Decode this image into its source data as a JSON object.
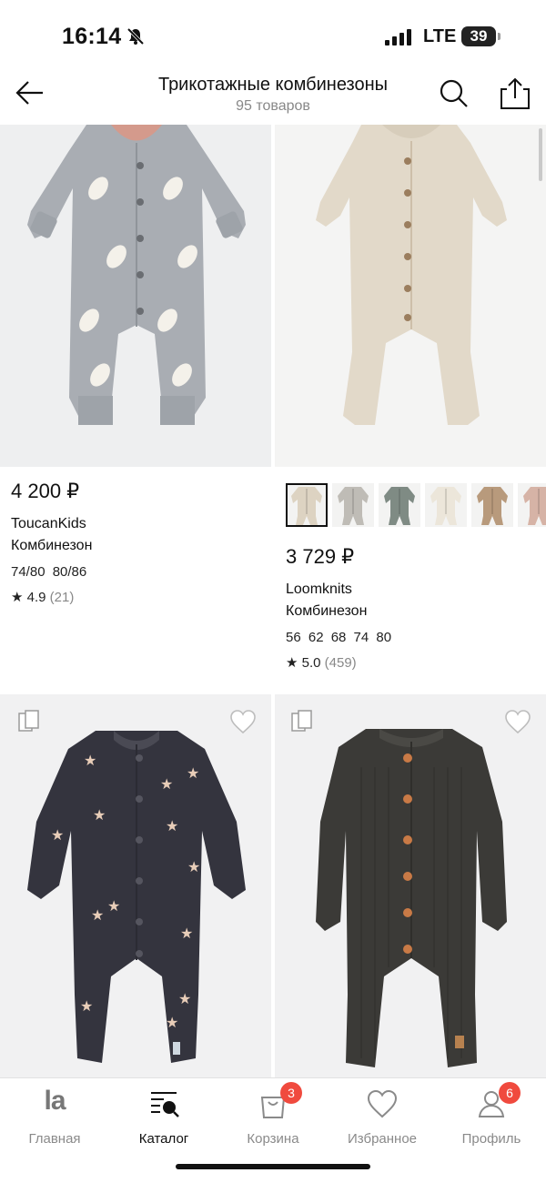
{
  "status_bar": {
    "time": "16:14",
    "network": "LTE",
    "battery": "39",
    "icons": [
      "bell-off-icon",
      "signal-bars-icon",
      "battery-icon"
    ]
  },
  "header": {
    "title": "Трикотажные комбинезоны",
    "subtitle": "95 товаров",
    "icons": [
      "back-arrow-icon",
      "search-icon",
      "share-icon"
    ]
  },
  "products": [
    {
      "price": "4 200 ₽",
      "brand": "ToucanKids",
      "type": "Комбинезон",
      "sizes": "74/80  80/86",
      "rating": "4.9",
      "reviews": "(21)",
      "color": "#a9adb3"
    },
    {
      "price": "3 729 ₽",
      "brand": "Loomknits",
      "type": "Комбинезон",
      "sizes": "56  62  68  74  80",
      "rating": "5.0",
      "reviews": "(459)",
      "color": "#e2d9c9",
      "color_variants": [
        "#ddd3c2",
        "#bfbcb6",
        "#7f8b84",
        "#ece6da",
        "#b89a7c",
        "#d6b3a6"
      ]
    },
    {
      "color": "#34343e",
      "accent": "#e8cdb8"
    },
    {
      "color": "#3b3a37",
      "accent": "#c97a46"
    }
  ],
  "tabs": [
    {
      "label": "Главная",
      "icon": "la-logo-icon",
      "logo_text": "la"
    },
    {
      "label": "Каталог",
      "icon": "catalog-search-icon",
      "active": true
    },
    {
      "label": "Корзина",
      "icon": "shopping-bag-icon",
      "badge": "3"
    },
    {
      "label": "Избранное",
      "icon": "heart-icon"
    },
    {
      "label": "Профиль",
      "icon": "profile-icon",
      "badge": "6"
    }
  ],
  "colors": {
    "accent": "#f04a3e",
    "muted_text": "#888888",
    "image_bg": "#eeeff0"
  }
}
